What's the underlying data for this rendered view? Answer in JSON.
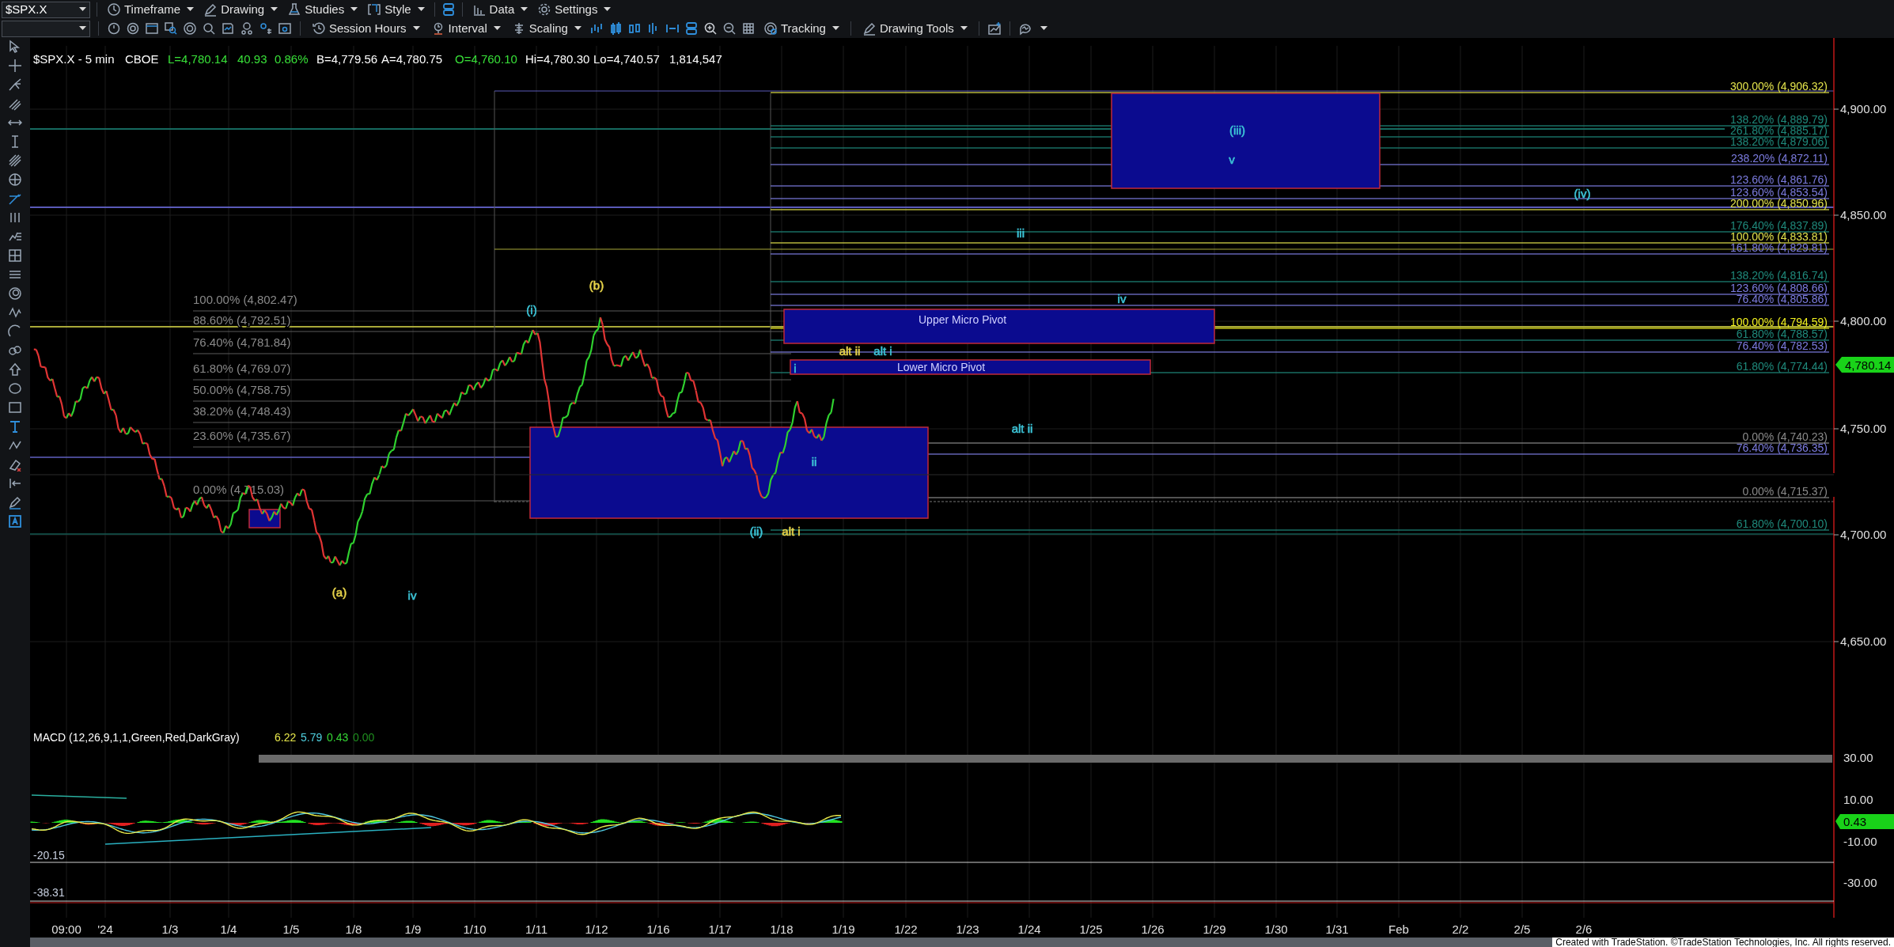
{
  "toolbar_top": {
    "symbol": "$SPX.X",
    "menus": [
      "Timeframe",
      "Drawing",
      "Studies",
      "Style",
      "Data",
      "Settings"
    ]
  },
  "toolbar_second": {
    "menus": [
      "Session Hours",
      "Interval",
      "Scaling",
      "Tracking",
      "Drawing Tools"
    ]
  },
  "chart_header": {
    "title": "$SPX.X - 5 min",
    "exchange": "CBOE",
    "quotes": [
      {
        "text": "L=4,780.14",
        "kind": "up"
      },
      {
        "text": "40.93",
        "kind": "up"
      },
      {
        "text": "0.86%",
        "kind": "up"
      },
      {
        "text": "B=4,779.56",
        "kind": "plain"
      },
      {
        "text": "A=4,780.75",
        "kind": "plain"
      },
      {
        "text": "O=4,760.10",
        "kind": "up"
      },
      {
        "text": "Hi=4,780.30",
        "kind": "plain"
      },
      {
        "text": "Lo=4,740.57",
        "kind": "plain"
      },
      {
        "text": "1,814,547",
        "kind": "plain"
      }
    ]
  },
  "fib_levels_left": [
    {
      "label": "100.00% (4,802.47)"
    },
    {
      "label": "88.60% (4,792.51)"
    },
    {
      "label": "76.40% (4,781.84)"
    },
    {
      "label": "61.80% (4,769.07)"
    },
    {
      "label": "50.00% (4,758.75)"
    },
    {
      "label": "38.20% (4,748.43)"
    },
    {
      "label": "23.60% (4,735.67)"
    },
    {
      "label": "0.00% (4,715.03)"
    }
  ],
  "fib_levels_right": [
    {
      "label": "300.00% (4,906.32)",
      "color": "#e4e44c"
    },
    {
      "label": "138.20% (4,889.79)",
      "color": "#1f8a7c"
    },
    {
      "label": "261.80% (4,885.17)",
      "color": "#1f8a7c"
    },
    {
      "label": "138.20% (4,879.06)",
      "color": "#1f8a7c"
    },
    {
      "label": "238.20% (4,872.11)",
      "color": "#7c7ce0"
    },
    {
      "label": "123.60% (4,861.76)",
      "color": "#7c7ce0"
    },
    {
      "label": "123.60% (4,853.54)",
      "color": "#7c7ce0"
    },
    {
      "label": "200.00% (4,850.96)",
      "color": "#e4e44c"
    },
    {
      "label": "176.40% (4,837.89)",
      "color": "#1f8a7c"
    },
    {
      "label": "100.00% (4,833.81)",
      "color": "#e4e44c"
    },
    {
      "label": "161.80% (4,829.81)",
      "color": "#7c7ce0"
    },
    {
      "label": "138.20% (4,816.74)",
      "color": "#1f8a7c"
    },
    {
      "label": "123.60% (4,808.66)",
      "color": "#7c7ce0"
    },
    {
      "label": "76.40% (4,805.86)",
      "color": "#7c7ce0"
    },
    {
      "label": "100.00% (4,794.59)",
      "color": "#f2f21e"
    },
    {
      "label": "61.80% (4,788.57)",
      "color": "#1f8a7c"
    },
    {
      "label": "76.40% (4,782.53)",
      "color": "#7c7ce0"
    },
    {
      "label": "61.80% (4,774.44)",
      "color": "#1f8a7c"
    },
    {
      "label": "0.00% (4,740.23)",
      "color": "#8a8a8a"
    },
    {
      "label": "76.40% (4,736.35)",
      "color": "#7c7ce0"
    },
    {
      "label": "0.00% (4,715.37)",
      "color": "#8a8a8a"
    },
    {
      "label": "61.80% (4,700.10)",
      "color": "#1f8a7c"
    }
  ],
  "zones": [
    {
      "label": "Upper Micro Pivot"
    },
    {
      "label": "Lower Micro Pivot"
    }
  ],
  "wave_labels": [
    {
      "text": "(i)",
      "color": "#3cc3d6"
    },
    {
      "text": "(b)",
      "color": "#e6d34a"
    },
    {
      "text": "(a)",
      "color": "#e6d34a"
    },
    {
      "text": "iv",
      "color": "#3cc3d6"
    },
    {
      "text": "i",
      "color": "#3cc3d6"
    },
    {
      "text": "alt ii",
      "color": "#e6d34a"
    },
    {
      "text": "alt i",
      "color": "#3cc3d6"
    },
    {
      "text": "ii",
      "color": "#3cc3d6"
    },
    {
      "text": "(ii)",
      "color": "#3cc3d6"
    },
    {
      "text": "alt i",
      "color": "#e6d34a"
    },
    {
      "text": "alt ii",
      "color": "#3cc3d6"
    },
    {
      "text": "iv",
      "color": "#3cc3d6"
    },
    {
      "text": "iii",
      "color": "#3cc3d6"
    },
    {
      "text": "(iii)",
      "color": "#3cc3d6"
    },
    {
      "text": "v",
      "color": "#3cc3d6"
    },
    {
      "text": "(iv)",
      "color": "#3cc3d6"
    }
  ],
  "price_axis": {
    "ticks": [
      "4,900.00",
      "4,850.00",
      "4,800.00",
      "4,750.00",
      "4,700.00",
      "4,650.00"
    ],
    "last_price": "4,780.14"
  },
  "macd": {
    "title": "MACD (12,26,9,1,1,Green,Red,DarkGray)",
    "values": [
      {
        "text": "6.22",
        "color": "#e6e64a"
      },
      {
        "text": "5.79",
        "color": "#4fd0e0"
      },
      {
        "text": "0.43",
        "color": "#35d835"
      },
      {
        "text": "0.00",
        "color": "#1f8f1f"
      }
    ],
    "left_labels": [
      "-20.15",
      "-38.31"
    ],
    "axis_ticks": [
      "30.00",
      "10.00",
      "-10.00",
      "-30.00"
    ],
    "last_value": "0.43"
  },
  "time_axis": {
    "ticks": [
      "09:00",
      "'24",
      "1/3",
      "1/4",
      "1/5",
      "1/8",
      "1/9",
      "1/10",
      "1/11",
      "1/12",
      "1/16",
      "1/17",
      "1/18",
      "1/19",
      "1/22",
      "1/23",
      "1/24",
      "1/25",
      "1/26",
      "1/29",
      "1/30",
      "1/31",
      "Feb",
      "2/2",
      "2/5",
      "2/6"
    ]
  },
  "footer": "Created with TradeStation. ©TradeStation Technologies, Inc. All rights reserved."
}
